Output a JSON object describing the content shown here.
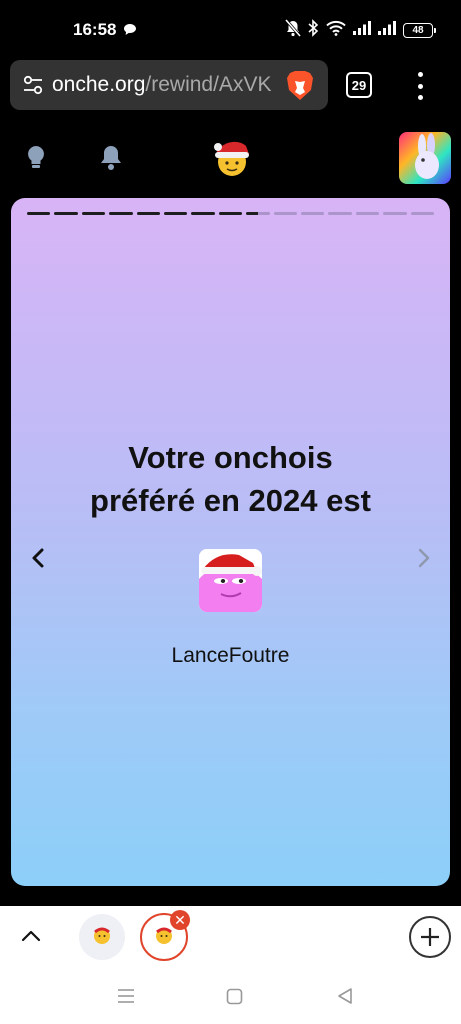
{
  "status_bar": {
    "time": "16:58",
    "battery": "48",
    "icons": [
      "chat-bubble-icon",
      "mute-icon",
      "bluetooth-icon",
      "wifi-icon",
      "signal-icon",
      "signal-icon",
      "battery-icon"
    ]
  },
  "browser": {
    "url_host": "onche.org",
    "url_path": "/rewind/AxVK",
    "tab_count": "29",
    "icons": [
      "site-settings-icon",
      "brave-lion-icon",
      "tab-count-icon",
      "more-vert-icon"
    ]
  },
  "site_header": {
    "icons": [
      "lightbulb-icon",
      "bell-icon",
      "santa-emoji-logo",
      "rabbit-avatar"
    ]
  },
  "story": {
    "progress": {
      "segments_total": 15,
      "segments_done": 8.5
    },
    "headline_line1": "Votre onchois",
    "headline_line2": "préféré en 2024 est",
    "username": "LanceFoutre",
    "icons": [
      "chevron-left-icon",
      "chevron-right-icon",
      "santa-hat-avatar"
    ]
  },
  "tab_strip": {
    "close_glyph": "✕",
    "icons": [
      "chevron-up-icon",
      "tab-favicon",
      "tab-favicon",
      "close-icon",
      "plus-icon"
    ]
  },
  "system_nav": {
    "icons": [
      "menu-icon",
      "home-icon",
      "back-icon"
    ]
  },
  "colors": {
    "card_top": "#d8b4f6",
    "card_bottom": "#8ccff9",
    "tab_active": "#e0452b",
    "url_bar": "#333333"
  }
}
